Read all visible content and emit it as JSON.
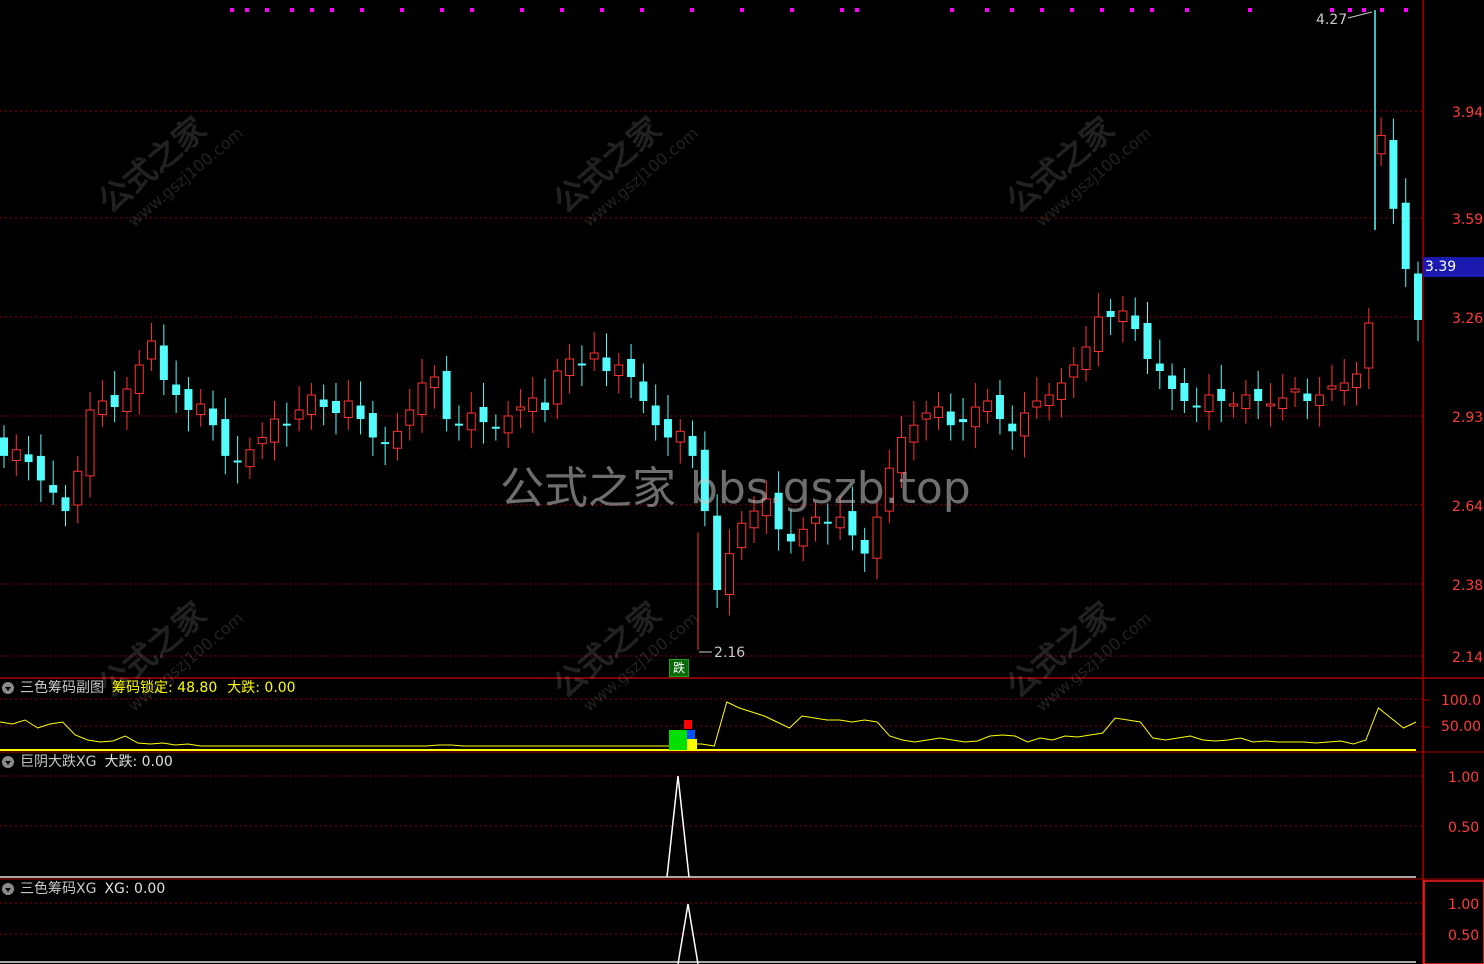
{
  "watermarks": {
    "site": "公式之家",
    "url": "www.gszj100.com",
    "center": "公式之家 bbs.gszb.top"
  },
  "main_chart": {
    "price_ticks": [
      "3.94",
      "3.59",
      "3.26",
      "2.93",
      "2.64",
      "2.38",
      "2.14"
    ],
    "current_price": "3.39",
    "high_label": "4.27",
    "low_label": "2.16",
    "signal_tag": "跌",
    "colors": {
      "up": "#ff3232",
      "down": "#54fcfc",
      "grid": "#8b0000",
      "magenta": "#ff00ff"
    }
  },
  "panel1": {
    "name": "三色筹码副图",
    "lock_label": "筹码锁定: 48.80",
    "die_label": "大跌: 0.00",
    "ticks": [
      "100.0",
      "50.00"
    ]
  },
  "panel2": {
    "name": "巨阴大跌XG",
    "die_label": "大跌: 0.00",
    "ticks": [
      "1.00",
      "0.50"
    ]
  },
  "panel3": {
    "name": "三色筹码XG",
    "xg_label": "XG: 0.00",
    "ticks": [
      "1.00",
      "0.50"
    ]
  }
}
